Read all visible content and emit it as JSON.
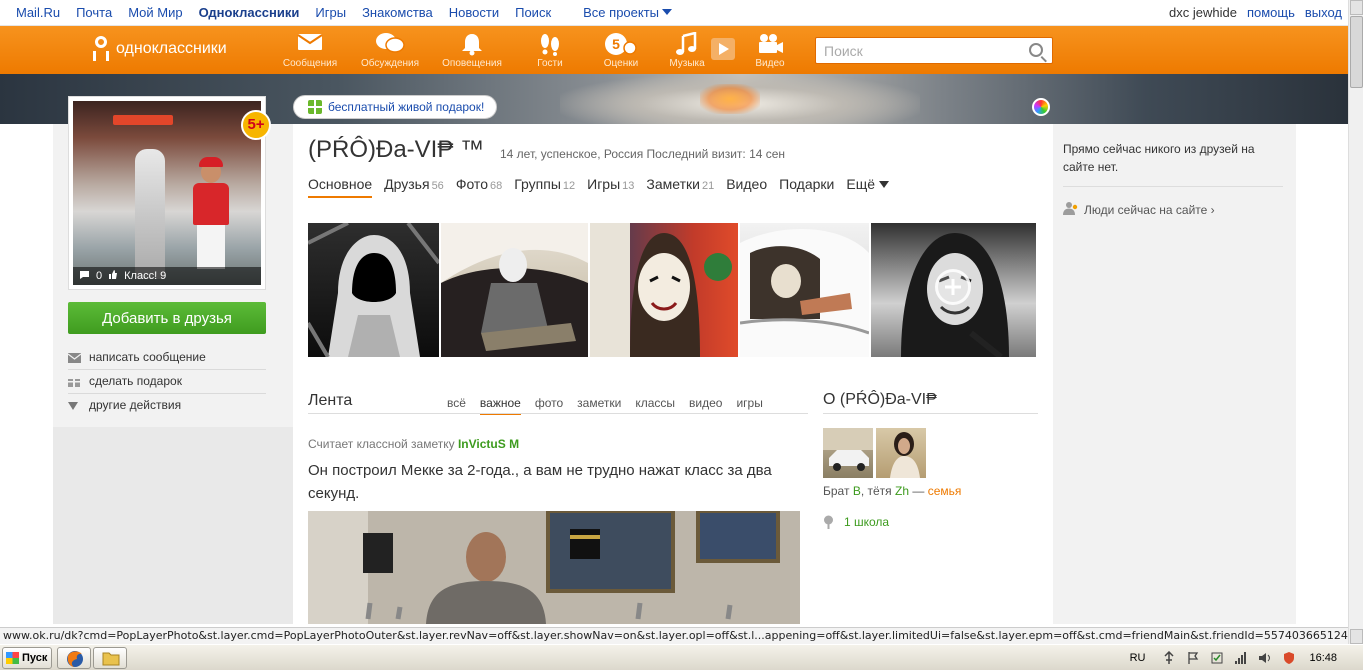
{
  "topbar": {
    "links": [
      "Mail.Ru",
      "Почта",
      "Мой Мир",
      "Одноклассники",
      "Игры",
      "Знакомства",
      "Новости",
      "Поиск",
      "Все проекты"
    ],
    "active_link": "Одноклассники",
    "user": "dxc jewhide",
    "help": "помощь",
    "logout": "выход"
  },
  "okbar": {
    "logo_text": "одноклассники",
    "nav": [
      {
        "label": "Сообщения",
        "icon": "envelope-icon"
      },
      {
        "label": "Обсуждения",
        "icon": "chat-bubbles-icon"
      },
      {
        "label": "Оповещения",
        "icon": "bell-icon"
      },
      {
        "label": "Гости",
        "icon": "footprints-icon"
      },
      {
        "label": "Оценки",
        "icon": "rating-5-icon"
      },
      {
        "label": "Музыка",
        "icon": "music-note-icon"
      },
      {
        "label": "Видео",
        "icon": "video-camera-icon"
      }
    ],
    "search_placeholder": "Поиск"
  },
  "gift_banner": "бесплатный живой подарок!",
  "profile": {
    "name": "(PŔÔ)Đa-VI₱ ™",
    "meta": "14 лет, успенское, Россия  Последний визит: 14 сен",
    "age_badge": "5+",
    "avatar_comments": "0",
    "avatar_likes": "Класс! 9",
    "add_friend": "Добавить в друзья",
    "actions": [
      "написать сообщение",
      "сделать подарок",
      "другие действия"
    ]
  },
  "tabs": [
    {
      "label": "Основное",
      "count": ""
    },
    {
      "label": "Друзья",
      "count": "56"
    },
    {
      "label": "Фото",
      "count": "68"
    },
    {
      "label": "Группы",
      "count": "12"
    },
    {
      "label": "Игры",
      "count": "13"
    },
    {
      "label": "Заметки",
      "count": "21"
    },
    {
      "label": "Видео",
      "count": ""
    },
    {
      "label": "Подарки",
      "count": ""
    },
    {
      "label": "Ещё",
      "count": ""
    }
  ],
  "active_tab": "Основное",
  "feed": {
    "title": "Лента",
    "filters": [
      "всё",
      "важное",
      "фото",
      "заметки",
      "классы",
      "видео",
      "игры"
    ],
    "active_filter": "важное",
    "author_prefix": "Считает классной заметку",
    "author": "InVictuS M",
    "text": "Он построил Мекке за 2-года., а вам не трудно нажат класс за два секунд."
  },
  "about": {
    "title": "О (PŔÔ)Đa-VI₱",
    "rel_prefix": "Брат",
    "rel1": "B",
    "rel_mid": ", тётя",
    "rel2": "Zh",
    "rel_dash": " — ",
    "rel_link": "семья",
    "school": "1 школа"
  },
  "right": {
    "online_note": "Прямо сейчас никого из друзей на сайте нет.",
    "people_now": "Люди сейчас на сайте ›"
  },
  "statusbar": "www.ok.ru/dk?cmd=PopLayerPhoto&st.layer.cmd=PopLayerPhotoOuter&st.layer.revNav=off&st.layer.showNav=on&st.layer.opl=off&st.l...appening=off&st.layer.limitedUi=false&st.layer.epm=off&st.cmd=friendMain&st.friendId=557403665124&st._aid=RecentPhotos_Zoom",
  "taskbar": {
    "start": "Пуск",
    "lang": "RU",
    "clock": "16:48"
  },
  "colors": {
    "orange": "#ee7a00",
    "green": "#3d9b1e",
    "link_blue": "#1a4cad"
  }
}
